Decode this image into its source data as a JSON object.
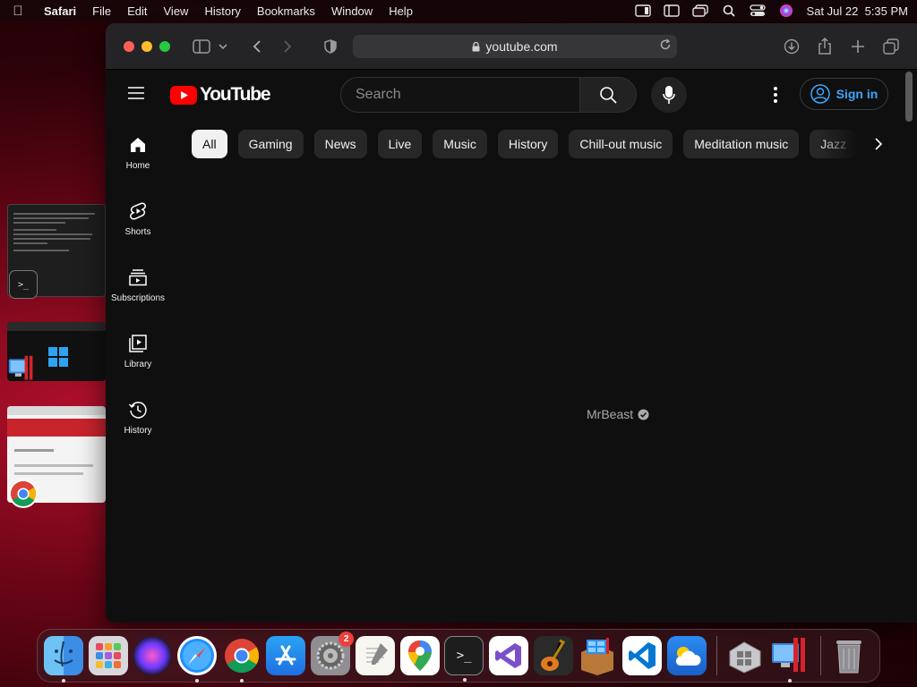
{
  "menubar": {
    "app_name": "Safari",
    "menus": [
      "File",
      "Edit",
      "View",
      "History",
      "Bookmarks",
      "Window",
      "Help"
    ],
    "clock": "Sat Jul 22  5:35 PM"
  },
  "browser": {
    "url": "youtube.com"
  },
  "youtube": {
    "logo_text": "YouTube",
    "search_placeholder": "Search",
    "sign_in_label": "Sign in",
    "guide": [
      {
        "label": "Home",
        "icon": "home-icon"
      },
      {
        "label": "Shorts",
        "icon": "shorts-icon"
      },
      {
        "label": "Subscriptions",
        "icon": "subscriptions-icon"
      },
      {
        "label": "Library",
        "icon": "library-icon"
      },
      {
        "label": "History",
        "icon": "history-icon"
      }
    ],
    "chips": [
      "All",
      "Gaming",
      "News",
      "Live",
      "Music",
      "History",
      "Chill-out music",
      "Meditation music",
      "Jazz"
    ],
    "active_chip": "All",
    "channel_name": "MrBeast"
  },
  "dock": {
    "apps": [
      "Finder",
      "Launchpad",
      "Siri",
      "Safari",
      "Google Chrome",
      "App Store",
      "System Settings",
      "TextEdit",
      "Google Maps",
      "Terminal",
      "Visual Studio",
      "GarageBand",
      "Parallels Windows",
      "Visual Studio Code",
      "Weather",
      "Boot Camp Assistant",
      "Parallels Desktop",
      "Trash"
    ],
    "settings_badge": "2"
  },
  "colors": {
    "youtube_red": "#ff0000",
    "link_blue": "#3ea6ff",
    "close": "#ff5f57",
    "minimize": "#febc2e",
    "zoom": "#28c840"
  }
}
